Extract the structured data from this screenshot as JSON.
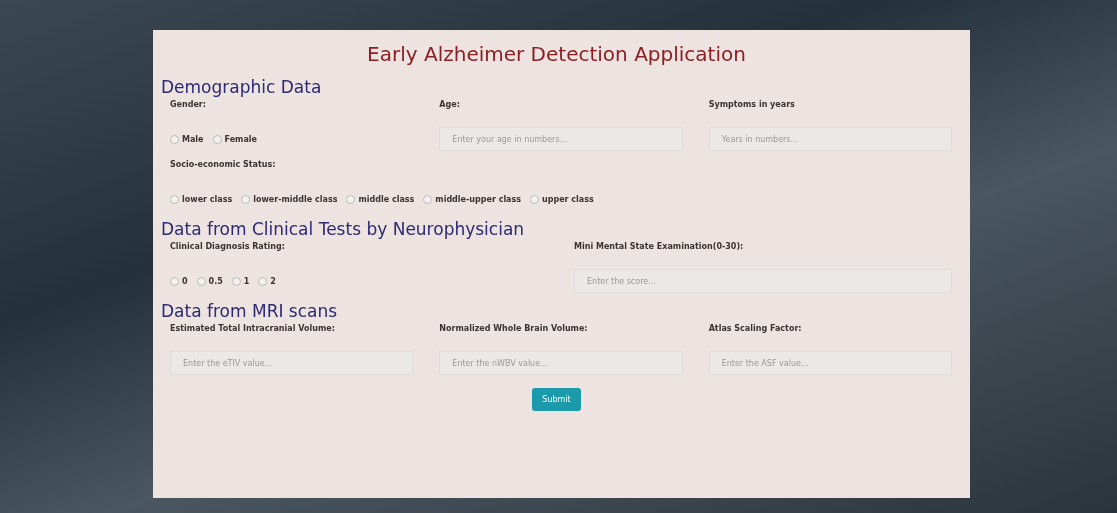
{
  "title": "Early Alzheimer Detection Application",
  "sections": [
    {
      "heading": "Demographic Data",
      "rows": [
        {
          "fields": [
            {
              "kind": "radio",
              "label": "Gender:",
              "options": [
                {
                  "label": "Male",
                  "selected": false
                },
                {
                  "label": "Female",
                  "selected": false
                }
              ]
            },
            {
              "kind": "text",
              "label": "Age:",
              "placeholder": "Enter your age in numbers..."
            },
            {
              "kind": "text",
              "label": "Symptoms in years",
              "placeholder": "Years in numbers..."
            }
          ]
        },
        {
          "fields": [
            {
              "kind": "radio",
              "label": "Socio-economic Status:",
              "options": [
                {
                  "label": "lower class",
                  "selected": false
                },
                {
                  "label": "lower-middle class",
                  "selected": false
                },
                {
                  "label": "middle class",
                  "selected": false
                },
                {
                  "label": "middle-upper class",
                  "selected": false
                },
                {
                  "label": "upper class",
                  "selected": false
                }
              ]
            }
          ]
        }
      ]
    },
    {
      "heading": "Data from Clinical Tests by Neurophysician",
      "rows": [
        {
          "fields": [
            {
              "kind": "radio",
              "label": "Clinical Diagnosis Rating:",
              "options": [
                {
                  "label": "0",
                  "selected": false
                },
                {
                  "label": "0.5",
                  "selected": false
                },
                {
                  "label": "1",
                  "selected": false
                },
                {
                  "label": "2",
                  "selected": false
                }
              ]
            },
            {
              "kind": "text",
              "label": "Mini Mental State Examination(0-30):",
              "placeholder": "Enter the score..."
            }
          ]
        }
      ]
    },
    {
      "heading": "Data from MRI scans",
      "rows": [
        {
          "fields": [
            {
              "kind": "text",
              "label": "Estimated Total Intracranial Volume:",
              "placeholder": "Enter the eTIV value..."
            },
            {
              "kind": "text",
              "label": "Normalized Whole Brain Volume:",
              "placeholder": "Enter the nWBV value..."
            },
            {
              "kind": "text",
              "label": "Atlas Scaling Factor:",
              "placeholder": "Enter the ASF value..."
            }
          ]
        }
      ]
    }
  ],
  "submit": "Submit"
}
